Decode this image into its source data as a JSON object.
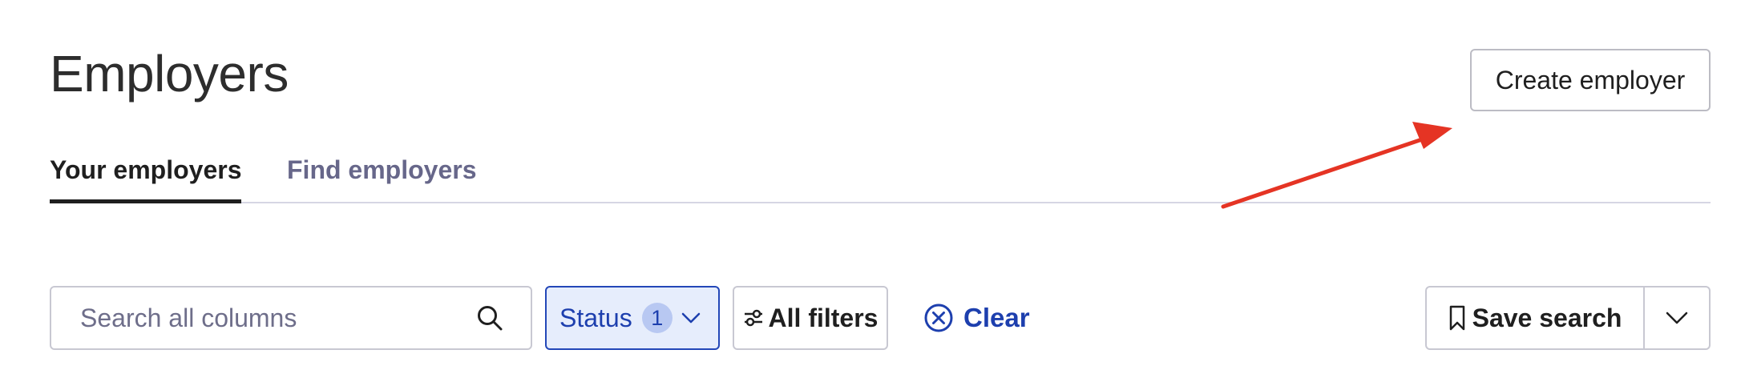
{
  "page": {
    "title": "Employers"
  },
  "header": {
    "create_button_label": "Create employer"
  },
  "tabs": [
    {
      "label": "Your employers",
      "active": true
    },
    {
      "label": "Find employers",
      "active": false
    }
  ],
  "toolbar": {
    "search": {
      "placeholder": "Search all columns",
      "value": "",
      "icon": "search-icon"
    },
    "status_filter": {
      "label": "Status",
      "count": "1",
      "icon": "chevron-down-icon"
    },
    "all_filters": {
      "label": "All filters",
      "icon": "sliders-icon"
    },
    "clear": {
      "label": "Clear",
      "icon": "x-circle-icon"
    },
    "save_search": {
      "label": "Save search",
      "icon": "bookmark-icon",
      "menu_icon": "chevron-down-icon"
    }
  },
  "colors": {
    "accent": "#1d3fae",
    "status_bg": "#e6edfc",
    "annotation_arrow": "#e53424",
    "tab_inactive": "#67678a"
  }
}
